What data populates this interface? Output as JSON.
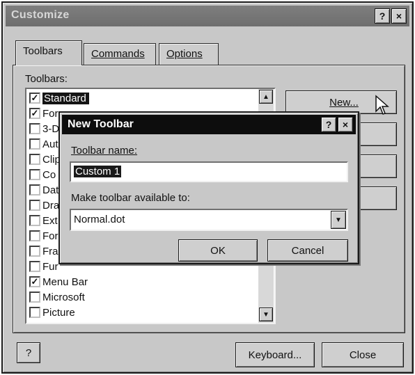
{
  "dialog": {
    "title": "Customize",
    "help_glyph": "?",
    "close_glyph": "×"
  },
  "tabs": [
    {
      "label": "Toolbars",
      "active": true
    },
    {
      "label": "Commands",
      "active": false
    },
    {
      "label": "Options",
      "active": false
    }
  ],
  "toolbars": {
    "list_label": "Toolbars:",
    "items": [
      {
        "label": "Standard",
        "checked": true,
        "selected": true
      },
      {
        "label": "Forma",
        "checked": true
      },
      {
        "label": "3-D",
        "checked": false
      },
      {
        "label": "Aut",
        "checked": false
      },
      {
        "label": "Clip",
        "checked": false
      },
      {
        "label": "Co",
        "checked": false
      },
      {
        "label": "Dat",
        "checked": false
      },
      {
        "label": "Dra",
        "checked": false
      },
      {
        "label": "Ext",
        "checked": false
      },
      {
        "label": "For",
        "checked": false
      },
      {
        "label": "Fra",
        "checked": false
      },
      {
        "label": "Fur",
        "checked": false
      },
      {
        "label": "Menu Bar",
        "checked": true
      },
      {
        "label": "Microsoft",
        "checked": false
      },
      {
        "label": "Picture",
        "checked": false
      }
    ],
    "buttons": {
      "new": "New...",
      "rename": "",
      "delete": "",
      "reset": ""
    }
  },
  "bottom": {
    "help_glyph": "?",
    "keyboard": "Keyboard...",
    "close": "Close"
  },
  "new_toolbar": {
    "title": "New Toolbar",
    "help_glyph": "?",
    "close_glyph": "×",
    "name_label": "Toolbar name:",
    "name_value": "Custom 1",
    "available_label": "Make toolbar available to:",
    "available_value": "Normal.dot",
    "ok": "OK",
    "cancel": "Cancel"
  }
}
